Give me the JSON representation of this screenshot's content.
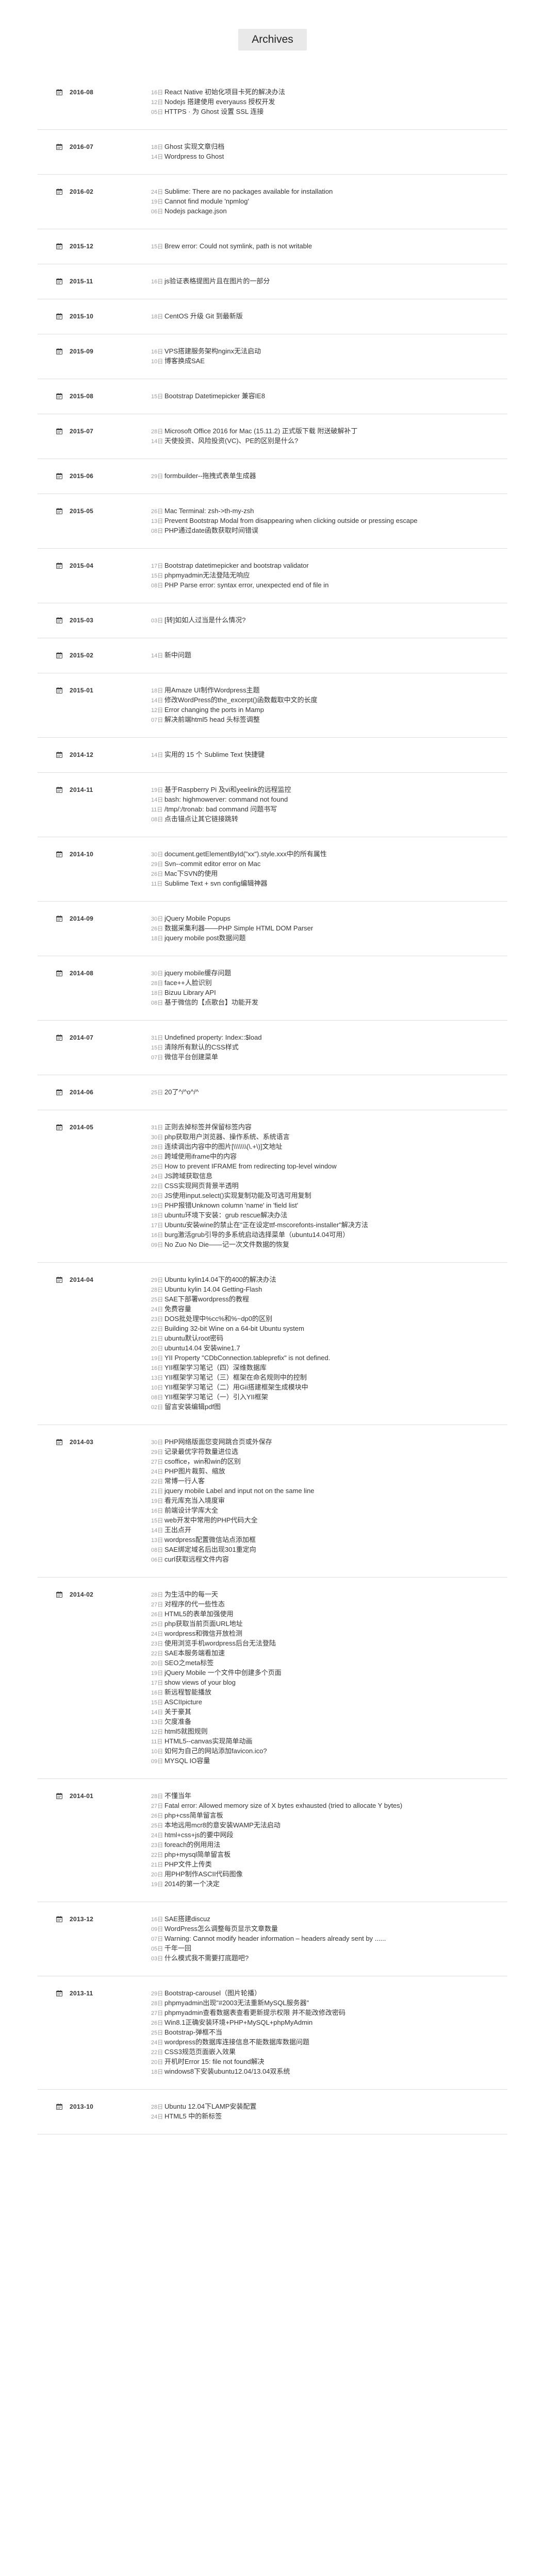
{
  "page": {
    "title": "Archives"
  },
  "months": [
    {
      "label": "2016-08",
      "posts": [
        {
          "day": "16日",
          "title": "React Native 初始化项目卡死的解决办法"
        },
        {
          "day": "12日",
          "title": "Nodejs 搭建使用 everyauss 授权开发"
        },
        {
          "day": "05日",
          "title": "HTTPS · 为 Ghost 设置 SSL 连接"
        }
      ]
    },
    {
      "label": "2016-07",
      "posts": [
        {
          "day": "18日",
          "title": "Ghost 实现文章归档"
        },
        {
          "day": "14日",
          "title": "Wordpress to Ghost"
        }
      ]
    },
    {
      "label": "2016-02",
      "posts": [
        {
          "day": "24日",
          "title": "Sublime: There are no packages available for installation"
        },
        {
          "day": "19日",
          "title": "Cannot find module 'npmlog'"
        },
        {
          "day": "06日",
          "title": "Nodejs package.json"
        }
      ]
    },
    {
      "label": "2015-12",
      "posts": [
        {
          "day": "15日",
          "title": "Brew error: Could not symlink, path is not writable"
        }
      ]
    },
    {
      "label": "2015-11",
      "posts": [
        {
          "day": "16日",
          "title": "js验证表格提图片且在图片的一部分"
        }
      ]
    },
    {
      "label": "2015-10",
      "posts": [
        {
          "day": "18日",
          "title": "CentOS 升级 Git 到最新版"
        }
      ]
    },
    {
      "label": "2015-09",
      "posts": [
        {
          "day": "16日",
          "title": "VPS搭建服务架构nginx无法启动"
        },
        {
          "day": "10日",
          "title": "博客换成SAE"
        }
      ]
    },
    {
      "label": "2015-08",
      "posts": [
        {
          "day": "15日",
          "title": "Bootstrap Datetimepicker 兼容IE8"
        }
      ]
    },
    {
      "label": "2015-07",
      "posts": [
        {
          "day": "28日",
          "title": "Microsoft Office 2016 for Mac (15.11.2) 正式版下载 附送破解补丁"
        },
        {
          "day": "14日",
          "title": "天使投资、风险投资(VC)、PE的区别是什么?"
        }
      ]
    },
    {
      "label": "2015-06",
      "posts": [
        {
          "day": "29日",
          "title": "formbuilder--拖拽式表单生成器"
        }
      ]
    },
    {
      "label": "2015-05",
      "posts": [
        {
          "day": "26日",
          "title": "Mac Terminal: zsh->th-my-zsh"
        },
        {
          "day": "13日",
          "title": "Prevent Bootstrap Modal from disappearing when clicking outside or pressing escape"
        },
        {
          "day": "08日",
          "title": "PHP通过date函数获取时间错误"
        }
      ]
    },
    {
      "label": "2015-04",
      "posts": [
        {
          "day": "17日",
          "title": "Bootstrap datetimepicker and bootstrap validator"
        },
        {
          "day": "15日",
          "title": "phpmyadmin无法登陆无响应"
        },
        {
          "day": "08日",
          "title": "PHP Parse error: syntax error, unexpected end of file in"
        }
      ]
    },
    {
      "label": "2015-03",
      "posts": [
        {
          "day": "03日",
          "title": "[转]如如人过当是什么情况?"
        }
      ]
    },
    {
      "label": "2015-02",
      "posts": [
        {
          "day": "14日",
          "title": "新中问题"
        }
      ]
    },
    {
      "label": "2015-01",
      "posts": [
        {
          "day": "18日",
          "title": "用Amaze UI制作Wordpress主题"
        },
        {
          "day": "14日",
          "title": "修改WordPress的the_excerpt()函数截取中文的长度"
        },
        {
          "day": "12日",
          "title": "Error changing the ports in Mamp"
        },
        {
          "day": "07日",
          "title": "解决前端html5 head 头标签调整"
        }
      ]
    },
    {
      "label": "2014-12",
      "posts": [
        {
          "day": "14日",
          "title": "实用的 15 个 Sublime Text 快捷键"
        }
      ]
    },
    {
      "label": "2014-11",
      "posts": [
        {
          "day": "19日",
          "title": "基于Raspberry Pi 及vi和yeelink的远程监控"
        },
        {
          "day": "14日",
          "title": "bash: highmowerver: command not found"
        },
        {
          "day": "11日",
          "title": "/tmp/:/tronab: bad command 问题书写"
        },
        {
          "day": "08日",
          "title": "点击锚点让其它链接跳转"
        }
      ]
    },
    {
      "label": "2014-10",
      "posts": [
        {
          "day": "30日",
          "title": "document.getElementById(\"xx\").style.xxx中的所有属性"
        },
        {
          "day": "29日",
          "title": "Svn--commit editor error on Mac"
        },
        {
          "day": "26日",
          "title": "Mac下SVN的使用"
        },
        {
          "day": "11日",
          "title": "Sublime Text + svn config编辑神器"
        }
      ]
    },
    {
      "label": "2014-09",
      "posts": [
        {
          "day": "30日",
          "title": "jQuery Mobile Popups"
        },
        {
          "day": "26日",
          "title": "数据采集利器——PHP Simple HTML DOM Parser"
        },
        {
          "day": "18日",
          "title": "jquery mobile post数据问题"
        }
      ]
    },
    {
      "label": "2014-08",
      "posts": [
        {
          "day": "30日",
          "title": "jquery mobile缓存问题"
        },
        {
          "day": "28日",
          "title": "face++人脸识别"
        },
        {
          "day": "18日",
          "title": "Bizuu Library API"
        },
        {
          "day": "08日",
          "title": "基于微信的【点歌台】功能开发"
        }
      ]
    },
    {
      "label": "2014-07",
      "posts": [
        {
          "day": "31日",
          "title": "Undefined property: Index::$load"
        },
        {
          "day": "15日",
          "title": "清除所有默认的CSS样式"
        },
        {
          "day": "07日",
          "title": "微信平台创建菜单"
        }
      ]
    },
    {
      "label": "2014-06",
      "posts": [
        {
          "day": "25日",
          "title": "20了^/^o^/^"
        }
      ]
    },
    {
      "label": "2014-05",
      "posts": [
        {
          "day": "31日",
          "title": "正则去掉标签并保留标签内容"
        },
        {
          "day": "30日",
          "title": "php获取用户浏览器、操作系统、系统语言"
        },
        {
          "day": "28日",
          "title": "连续调出内容中的图片[\\\\\\\\\\\\\\(\\.+\\)]文地址"
        },
        {
          "day": "26日",
          "title": "跨域使用iframe中的内容"
        },
        {
          "day": "25日",
          "title": "How to prevent IFRAME from redirecting top-level window"
        },
        {
          "day": "24日",
          "title": "JS跨域获取信息"
        },
        {
          "day": "22日",
          "title": "CSS实现网页背景半透明"
        },
        {
          "day": "20日",
          "title": "JS使用input.select()实现复制功能及可选可用复制"
        },
        {
          "day": "19日",
          "title": "PHP报错Unknown column 'name' in 'field list'"
        },
        {
          "day": "18日",
          "title": "ubuntu环境下安装：grub rescue解决办法"
        },
        {
          "day": "17日",
          "title": "Ubuntu安装wine的禁止在\"正在设定ttf-mscorefonts-installer\"解决方法"
        },
        {
          "day": "16日",
          "title": "burg激活grub引导的多系统启动选择菜单（ubuntu14.04可用）"
        },
        {
          "day": "09日",
          "title": "No Zuo No Die——记一次文件数据的恢复"
        }
      ]
    },
    {
      "label": "2014-04",
      "posts": [
        {
          "day": "29日",
          "title": "Ubuntu kylin14.04下的400的解决办法"
        },
        {
          "day": "28日",
          "title": "Ubuntu kylin 14.04 Getting-Flash"
        },
        {
          "day": "25日",
          "title": "SAE下部署wordpress的教程"
        },
        {
          "day": "24日",
          "title": "免费容量"
        },
        {
          "day": "23日",
          "title": "DOS批处理中%cc%和%~dp0的区别"
        },
        {
          "day": "22日",
          "title": "Building 32-bit Wine on a 64-bit Ubuntu system"
        },
        {
          "day": "21日",
          "title": "ubuntu默认root密码"
        },
        {
          "day": "20日",
          "title": "ubuntu14.04 安装wine1.7"
        },
        {
          "day": "19日",
          "title": "YII Property \"CDbConnection.tableprefix\" is not defined."
        },
        {
          "day": "16日",
          "title": "YII框架学习笔记（四）深维数据库"
        },
        {
          "day": "13日",
          "title": "YII框架学习笔记（三）框架在命名规则中的控制"
        },
        {
          "day": "10日",
          "title": "YII框架学习笔记（二）用Gii搭建框架生成模块中"
        },
        {
          "day": "08日",
          "title": "YII框架学习笔记（一）引入YII框架"
        },
        {
          "day": "02日",
          "title": "留言安装编辑pdf图"
        }
      ]
    },
    {
      "label": "2014-03",
      "posts": [
        {
          "day": "30日",
          "title": "PHP网络版面您变网跳合页或外保存"
        },
        {
          "day": "29日",
          "title": "记录最优字符数量进位选"
        },
        {
          "day": "27日",
          "title": "csoffice，win和win的区别"
        },
        {
          "day": "24日",
          "title": "PHP图片裁剪、缩放"
        },
        {
          "day": "22日",
          "title": "常博一行人客"
        },
        {
          "day": "21日",
          "title": "jquery mobile Label and input not on the same line"
        },
        {
          "day": "19日",
          "title": "看元库充当入境度审"
        },
        {
          "day": "16日",
          "title": "前端设计学库大全"
        },
        {
          "day": "15日",
          "title": "web开发中常用的PHP代码大全"
        },
        {
          "day": "14日",
          "title": "王出点开"
        },
        {
          "day": "13日",
          "title": "wordpress配置微信站点添加框"
        },
        {
          "day": "08日",
          "title": "SAE绑定域名后出现301重定向"
        },
        {
          "day": "06日",
          "title": "curl获取远程文件内容"
        }
      ]
    },
    {
      "label": "2014-02",
      "posts": [
        {
          "day": "28日",
          "title": "为生活中的每一天"
        },
        {
          "day": "27日",
          "title": "对程序的代一些性态"
        },
        {
          "day": "26日",
          "title": "HTML5的表单加强使用"
        },
        {
          "day": "25日",
          "title": "php获取当前页面URL地址"
        },
        {
          "day": "24日",
          "title": "wordpress和微信开放检测"
        },
        {
          "day": "23日",
          "title": "使用浏览手机wordpress后台无法登陆"
        },
        {
          "day": "22日",
          "title": "SAE本服务端看加速"
        },
        {
          "day": "20日",
          "title": "SEO之meta标签"
        },
        {
          "day": "19日",
          "title": "jQuery Mobile 一个文件中创建多个页面"
        },
        {
          "day": "17日",
          "title": "show views of your blog"
        },
        {
          "day": "16日",
          "title": "新远程智能播放"
        },
        {
          "day": "15日",
          "title": "ASCIIpicture"
        },
        {
          "day": "14日",
          "title": "关于豪其"
        },
        {
          "day": "13日",
          "title": "欠度准备"
        },
        {
          "day": "12日",
          "title": "html5就图规则"
        },
        {
          "day": "11日",
          "title": "HTML5--canvas实现简单动画"
        },
        {
          "day": "10日",
          "title": "如何为自己的网站添加favicon.ico?"
        },
        {
          "day": "09日",
          "title": "MYSQL IO容量"
        }
      ]
    },
    {
      "label": "2014-01",
      "posts": [
        {
          "day": "28日",
          "title": "不懂当年"
        },
        {
          "day": "27日",
          "title": "Fatal error: Allowed memory size of X bytes exhausted (tried to allocate Y bytes)"
        },
        {
          "day": "26日",
          "title": "php+css简单留言板"
        },
        {
          "day": "25日",
          "title": "本地远用mcr8的意安装WAMP无法启动"
        },
        {
          "day": "24日",
          "title": "html+css+js的要中网段"
        },
        {
          "day": "23日",
          "title": "foreach的例用用法"
        },
        {
          "day": "22日",
          "title": "php+mysql简单留言板"
        },
        {
          "day": "21日",
          "title": "PHP文件上传类"
        },
        {
          "day": "20日",
          "title": "用PHP制作ASCII代码图像"
        },
        {
          "day": "19日",
          "title": "2014的第一个决定"
        }
      ]
    },
    {
      "label": "2013-12",
      "posts": [
        {
          "day": "16日",
          "title": "SAE搭建discuz"
        },
        {
          "day": "09日",
          "title": "WordPress怎么调整每页显示文章数量"
        },
        {
          "day": "07日",
          "title": "Warning: Cannot modify header information – headers already sent by ......"
        },
        {
          "day": "05日",
          "title": "千年一回"
        },
        {
          "day": "03日",
          "title": "什么模式我不需要打底题吧?"
        }
      ]
    },
    {
      "label": "2013-11",
      "posts": [
        {
          "day": "29日",
          "title": "Bootstrap-carousel（图片轮播）"
        },
        {
          "day": "28日",
          "title": "phpmyadmin出现\"#2003无法重新MySQL服务器\""
        },
        {
          "day": "27日",
          "title": "phpmyadmin查看数据表查看更新提示权限 并不能改修改密码"
        },
        {
          "day": "26日",
          "title": "Win8.1正确安装环境+PHP+MySQL+phpMyAdmin"
        },
        {
          "day": "25日",
          "title": "Bootstrap-弹框不当"
        },
        {
          "day": "24日",
          "title": "wordpress的数据库连接信息不能数据库数据问题"
        },
        {
          "day": "22日",
          "title": "CSS3规范页面嵌入效果"
        },
        {
          "day": "20日",
          "title": "开机时Error 15: file not found解决"
        },
        {
          "day": "18日",
          "title": "windows8下安装ubuntu12.04/13.04双系统"
        }
      ]
    },
    {
      "label": "2013-10",
      "posts": [
        {
          "day": "28日",
          "title": "Ubuntu 12.04下LAMP安装配置"
        },
        {
          "day": "24日",
          "title": "HTML5 中的新标签"
        }
      ]
    }
  ]
}
